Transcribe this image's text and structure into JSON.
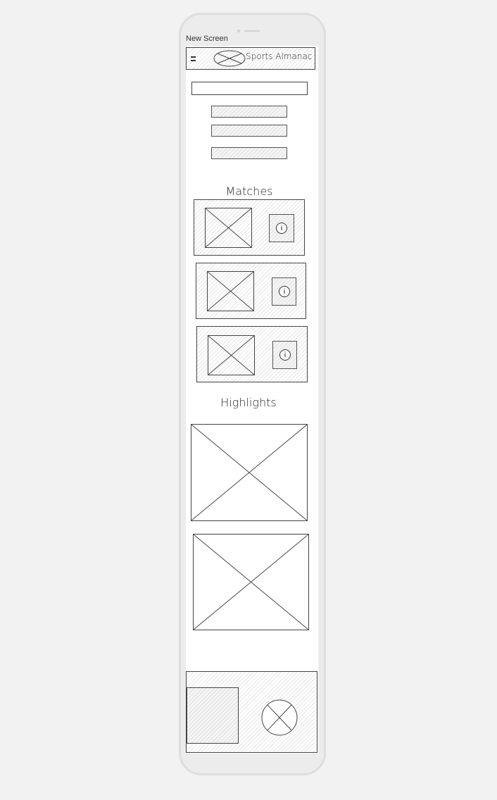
{
  "screen_title": "New Screen",
  "header": {
    "title": "Sports Almanac",
    "menu_icon": "menu-icon",
    "logo": "image-placeholder"
  },
  "sections": {
    "matches": "Matches",
    "highlights": "Highlights"
  },
  "match_cards": [
    {
      "icon": "info-icon"
    },
    {
      "icon": "info-icon"
    },
    {
      "icon": "info-icon"
    }
  ],
  "info_glyph": "i"
}
